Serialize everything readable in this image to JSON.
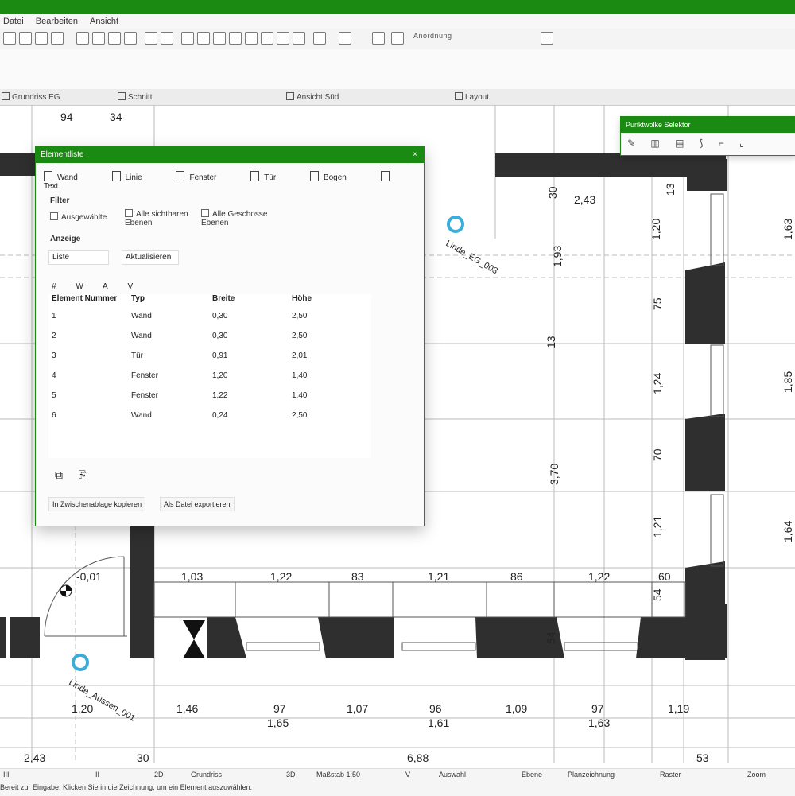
{
  "menu": {
    "items": [
      "Datei",
      "Bearbeiten",
      "Ansicht"
    ]
  },
  "toolbar": {
    "view_label": "Anordnung"
  },
  "tabs": [
    {
      "label": "Grundriss EG"
    },
    {
      "label": "Schnitt"
    },
    {
      "label": "Ansicht Süd"
    },
    {
      "label": "Layout"
    }
  ],
  "drawing": {
    "dims_top": [
      "94",
      "34",
      "30",
      "2,43",
      "13"
    ],
    "dims_right_inner": [
      "1,20",
      "75",
      "1,24",
      "70",
      "1,21",
      "60",
      "54"
    ],
    "dims_right_outer": [
      "1,63",
      "1,85",
      "1,64"
    ],
    "dims_vertical_mid": [
      "1,93",
      "13",
      "3,70"
    ],
    "dims_row1": [
      "1,03",
      "1,22",
      "83",
      "1,21",
      "86",
      "1,22"
    ],
    "dims_row2": [
      "1,20",
      "1,46",
      "97",
      "1,07",
      "96",
      "1,09",
      "97",
      "1,19"
    ],
    "dims_row2b": [
      "1,65",
      "1,61",
      "1,63"
    ],
    "dims_row3": [
      "2,43",
      "30",
      "6,88",
      "53"
    ],
    "level": "-0,01",
    "marker1": "Linde_EG_003",
    "marker2": "Linde_Aussen_001",
    "dim_54": "54"
  },
  "dialog": {
    "title": "Elementliste",
    "close_icon": "×",
    "tools": [
      "Wand",
      "Linie",
      "Fenster",
      "Tür",
      "Bogen",
      "Text"
    ],
    "section_filter": "Filter",
    "chk1": "Ausgewählte",
    "chk2": "Alle sichtbaren Ebenen",
    "chk3": "Alle Geschosse Ebenen",
    "section_display": "Anzeige",
    "field1": "Liste",
    "field2": "Aktualisieren",
    "col_icons": [
      "#",
      "W",
      "A",
      "V"
    ],
    "headers": [
      "Element Nummer",
      "Typ",
      "Breite",
      "Höhe"
    ],
    "rows": [
      [
        "1",
        "Wand",
        "0,30",
        "2,50"
      ],
      [
        "2",
        "Wand",
        "0,30",
        "2,50"
      ],
      [
        "3",
        "Tür",
        "0,91",
        "2,01"
      ],
      [
        "4",
        "Fenster",
        "1,20",
        "1,40"
      ],
      [
        "5",
        "Fenster",
        "1,22",
        "1,40"
      ],
      [
        "6",
        "Wand",
        "0,24",
        "2,50"
      ]
    ],
    "btn1": "In Zwischenablage kopieren",
    "btn2": "Als Datei exportieren"
  },
  "palette": {
    "title": "Punktwolke Selektor"
  },
  "status": {
    "row1": [
      "III",
      "II",
      "2D",
      "Grundriss",
      "3D",
      "Maßstab 1:50",
      "V",
      "Auswahl",
      "Ebene",
      "Planzeichnung",
      "Raster",
      "Zoom"
    ],
    "row2": "Bereit zur Eingabe. Klicken Sie in die Zeichnung, um ein Element auszuwählen."
  },
  "colors": {
    "accent": "#1a8a12",
    "wall": "#2f2f2f"
  }
}
